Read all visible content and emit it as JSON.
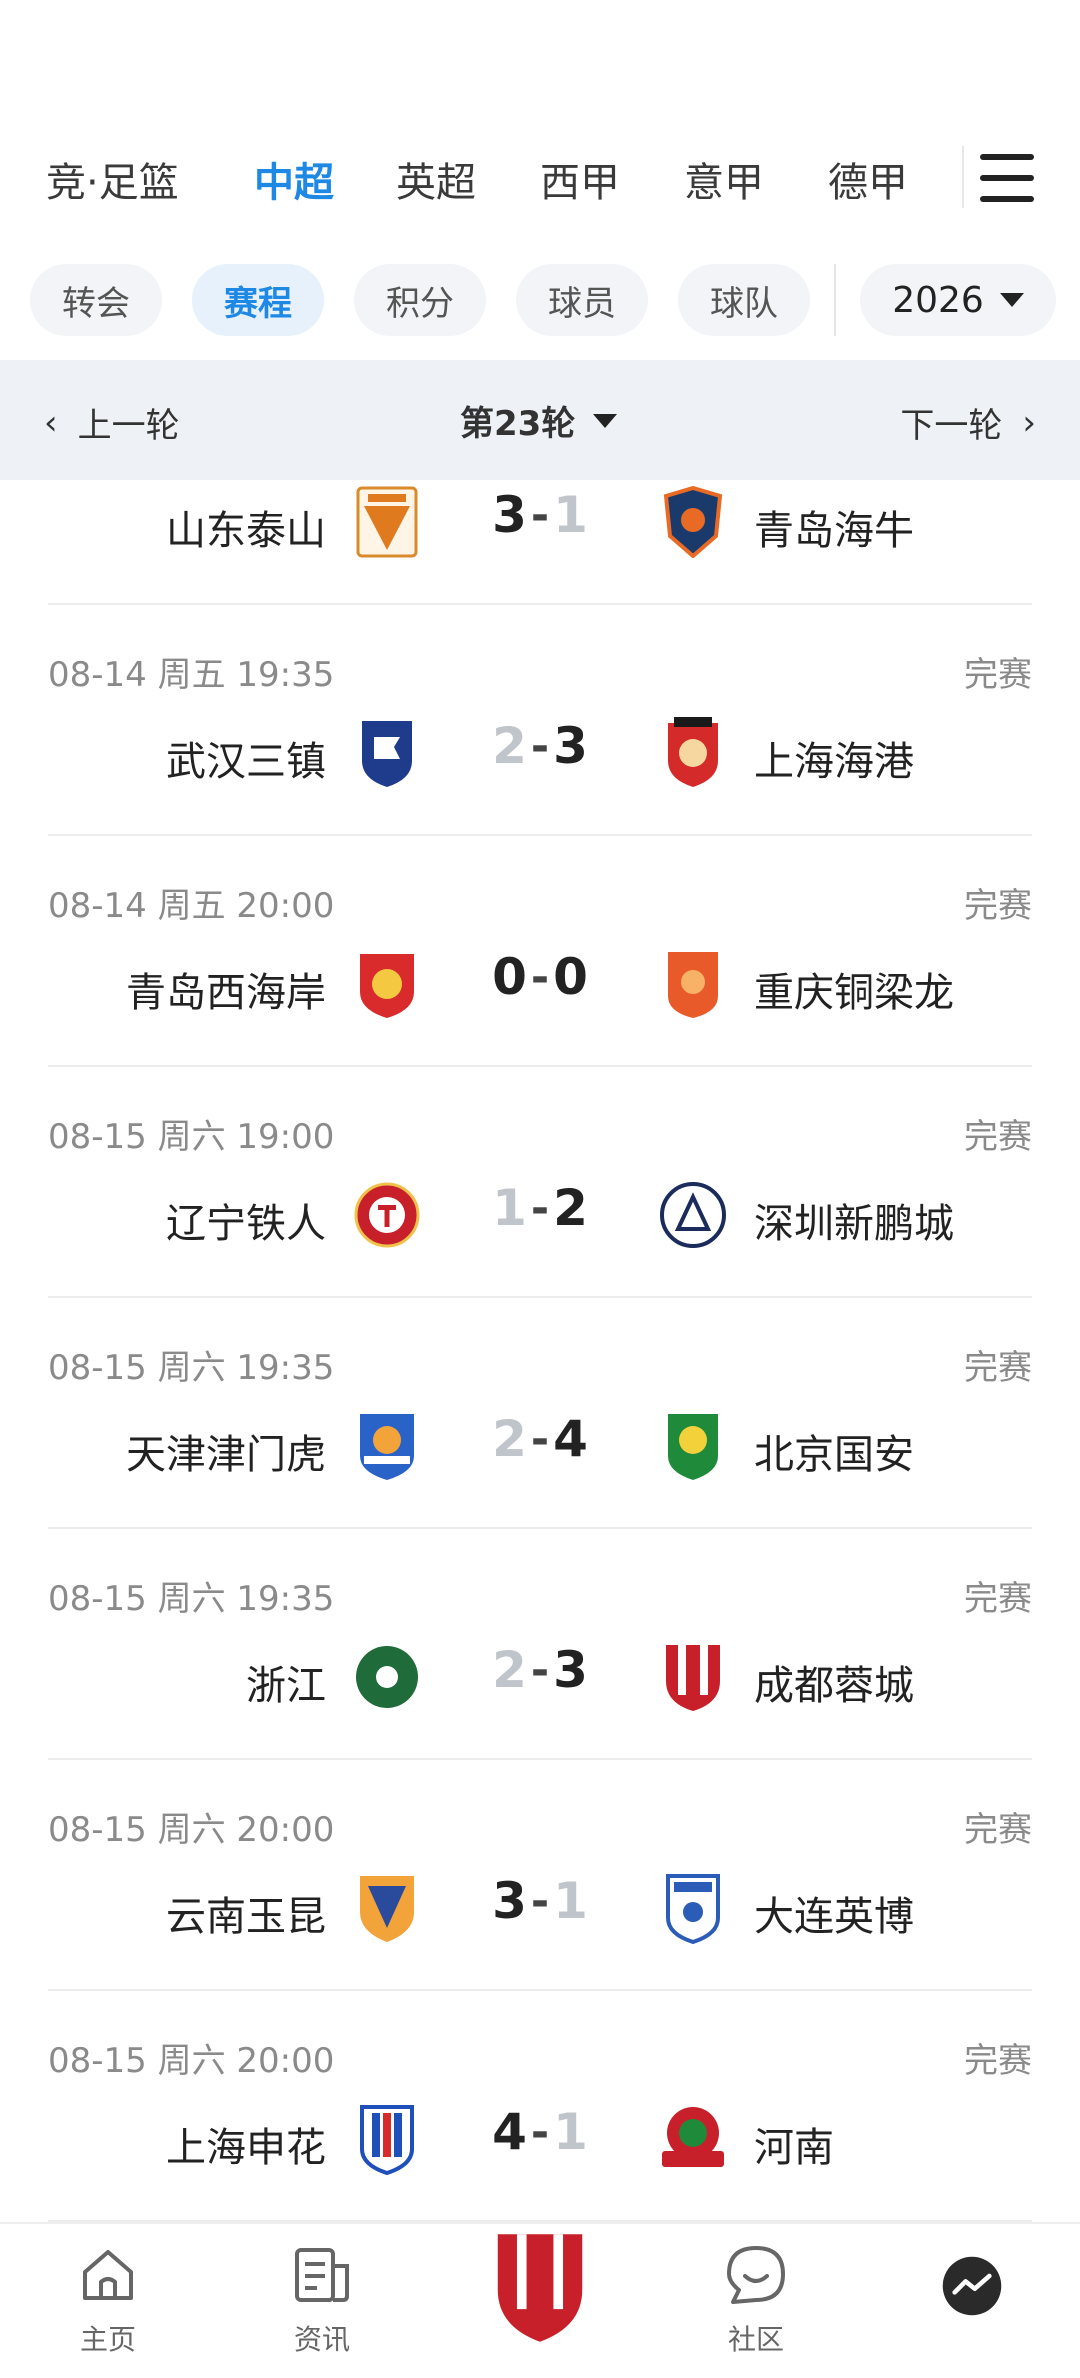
{
  "league_tabs": [
    "竞·足篮",
    "中超",
    "英超",
    "西甲",
    "意甲",
    "德甲"
  ],
  "active_league": "中超",
  "sub_tabs": [
    "转会",
    "赛程",
    "积分",
    "球员",
    "球队"
  ],
  "active_sub": "赛程",
  "year": "2026",
  "round": {
    "prev": "上一轮",
    "current": "第23轮",
    "next": "下一轮"
  },
  "matches": [
    {
      "time": "",
      "status": "",
      "home": "山东泰山",
      "away": "青岛海牛",
      "home_score": "3",
      "away_score": "1"
    },
    {
      "time": "08-14 周五 19:35",
      "status": "完赛",
      "home": "武汉三镇",
      "away": "上海海港",
      "home_score": "2",
      "away_score": "3"
    },
    {
      "time": "08-14 周五 20:00",
      "status": "完赛",
      "home": "青岛西海岸",
      "away": "重庆铜梁龙",
      "home_score": "0",
      "away_score": "0"
    },
    {
      "time": "08-15 周六 19:00",
      "status": "完赛",
      "home": "辽宁铁人",
      "away": "深圳新鹏城",
      "home_score": "1",
      "away_score": "2"
    },
    {
      "time": "08-15 周六 19:35",
      "status": "完赛",
      "home": "天津津门虎",
      "away": "北京国安",
      "home_score": "2",
      "away_score": "4"
    },
    {
      "time": "08-15 周六 19:35",
      "status": "完赛",
      "home": "浙江",
      "away": "成都蓉城",
      "home_score": "2",
      "away_score": "3"
    },
    {
      "time": "08-15 周六 20:00",
      "status": "完赛",
      "home": "云南玉昆",
      "away": "大连英博",
      "home_score": "3",
      "away_score": "1"
    },
    {
      "time": "08-15 周六 20:00",
      "status": "完赛",
      "home": "上海申花",
      "away": "河南",
      "home_score": "4",
      "away_score": "1"
    }
  ],
  "bottom_nav": {
    "home": "主页",
    "news": "资讯",
    "community": "社区"
  },
  "colors": {
    "accent": "#1e88e5",
    "chip_bg": "#f2f4f7",
    "round_bar_bg": "#eef1f5",
    "lose_score": "#c0c4cb"
  }
}
